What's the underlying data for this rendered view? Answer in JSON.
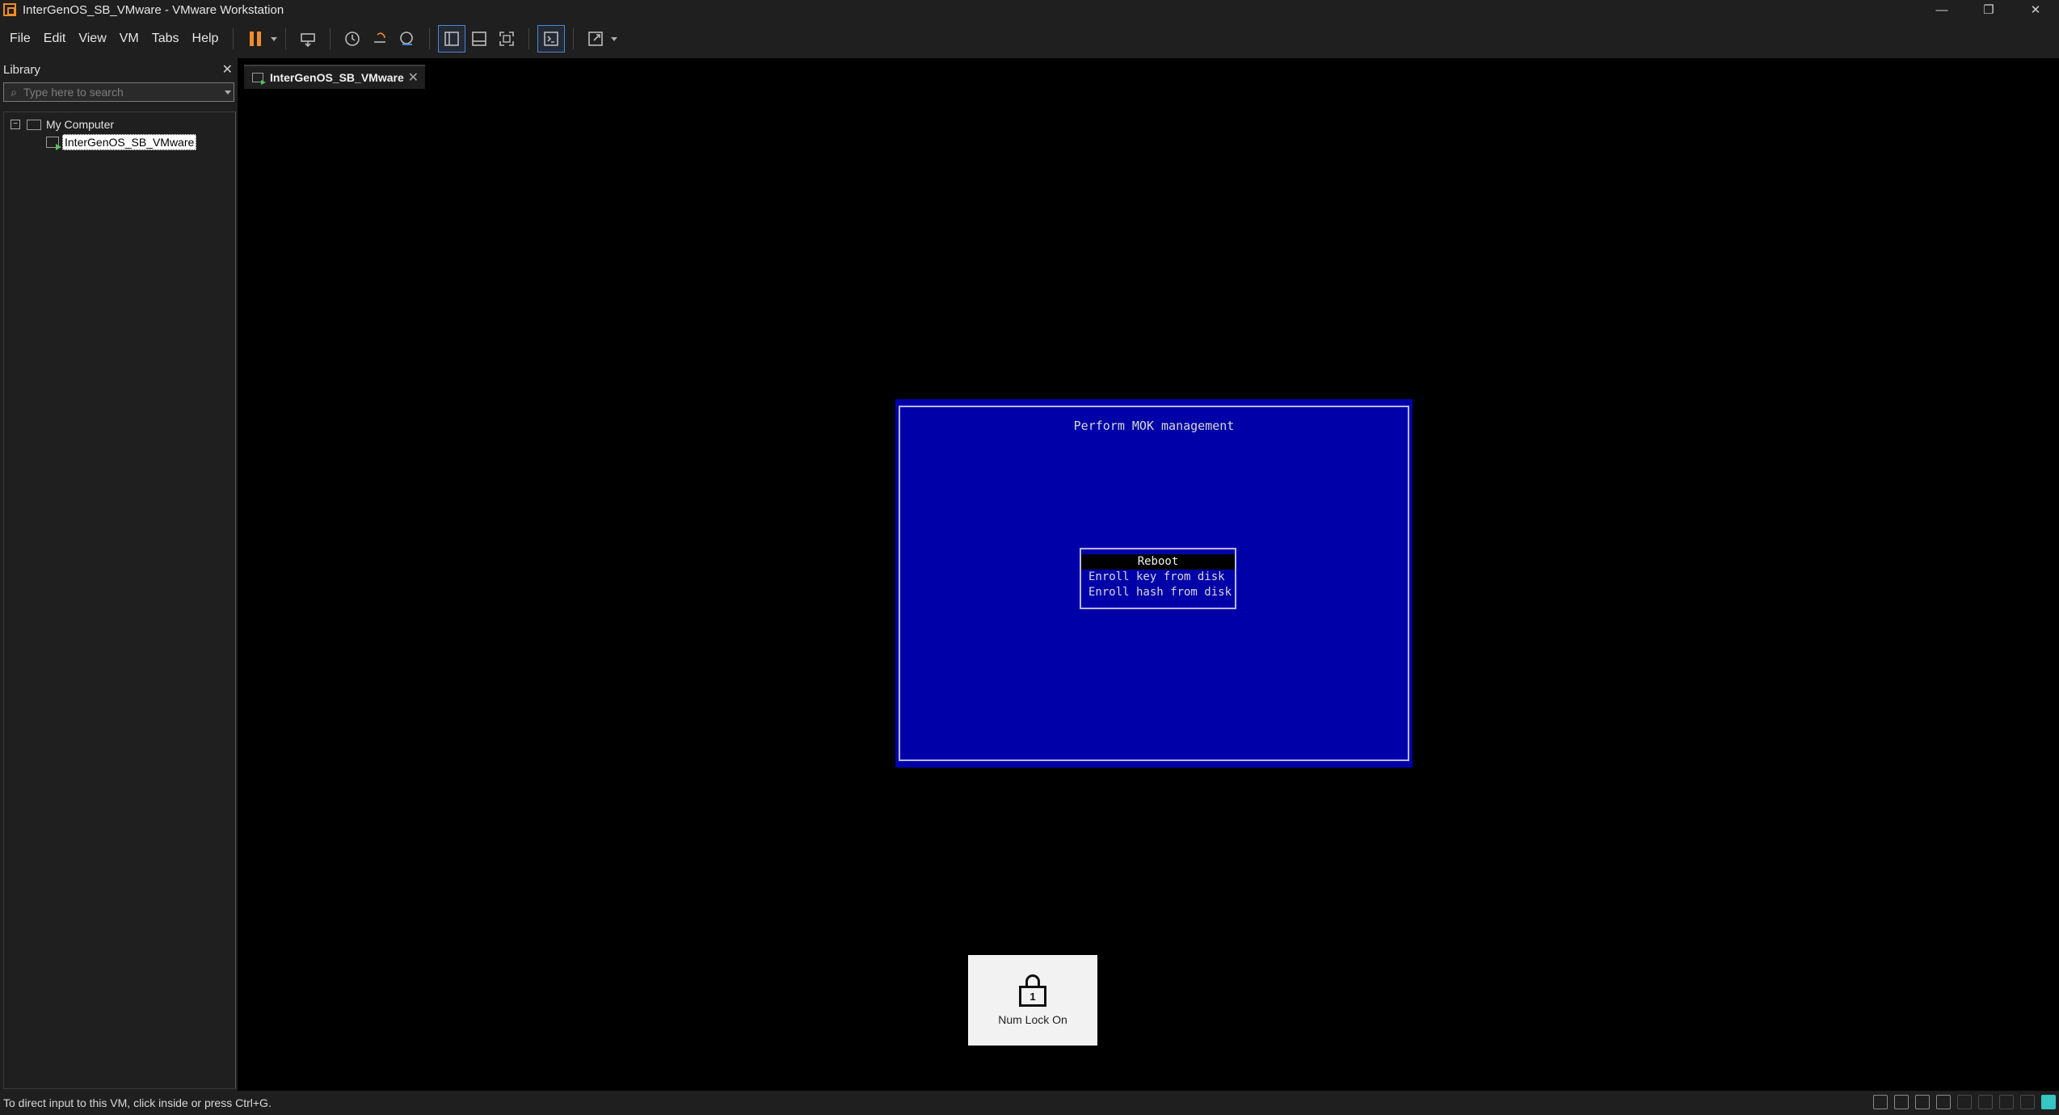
{
  "window": {
    "title": "InterGenOS_SB_VMware - VMware Workstation",
    "minimize_glyph": "—",
    "restore_glyph": "❐",
    "close_glyph": "✕"
  },
  "menu": {
    "file": "File",
    "edit": "Edit",
    "view": "View",
    "vm": "VM",
    "tabs": "Tabs",
    "help": "Help"
  },
  "toolbar": {
    "icons": [
      "pause-icon",
      "send-ctrl-alt-del-icon",
      "snapshot-icon",
      "revert-snapshot-icon",
      "snapshot-manager-icon",
      "show-library-icon",
      "show-thumbnail-icon",
      "full-screen-icon",
      "console-view-icon",
      "stretch-guest-icon"
    ]
  },
  "library": {
    "title": "Library",
    "close_glyph": "✕",
    "search_placeholder": "Type here to search",
    "tree": {
      "root_label": "My Computer",
      "expander": "−",
      "vm_label": "InterGenOS_SB_VMware"
    }
  },
  "tab": {
    "label": "InterGenOS_SB_VMware",
    "close_glyph": "✕"
  },
  "mok": {
    "title": "Perform MOK management",
    "items": [
      "Reboot",
      "Enroll key from disk",
      "Enroll hash from disk"
    ],
    "selected_index": 0,
    "background_color": "#0000a8"
  },
  "notification": {
    "lock_number": "1",
    "text": "Num Lock On"
  },
  "status": {
    "text": "To direct input to this VM, click inside or press Ctrl+G."
  },
  "colors": {
    "accent_orange": "#f28c28",
    "accent_blue": "#4a86d9",
    "status_teal": "#36c6c6"
  }
}
